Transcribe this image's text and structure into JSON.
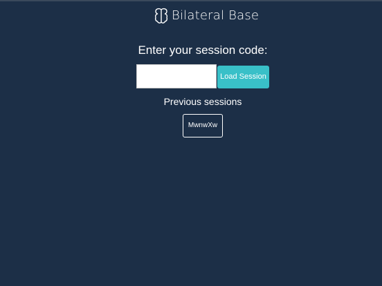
{
  "app": {
    "brand_name": "Bilateral Base",
    "logo_icon": "bilateral-brain-logo-icon"
  },
  "session": {
    "prompt": "Enter your session code:",
    "input_value": "",
    "input_placeholder": "",
    "load_button_label": "Load Session"
  },
  "previous": {
    "heading": "Previous sessions",
    "sessions": [
      {
        "code": "MwnwXw"
      }
    ]
  },
  "colors": {
    "background": "#1c2f47",
    "accent": "#39c0c8",
    "text": "#ffffff"
  }
}
